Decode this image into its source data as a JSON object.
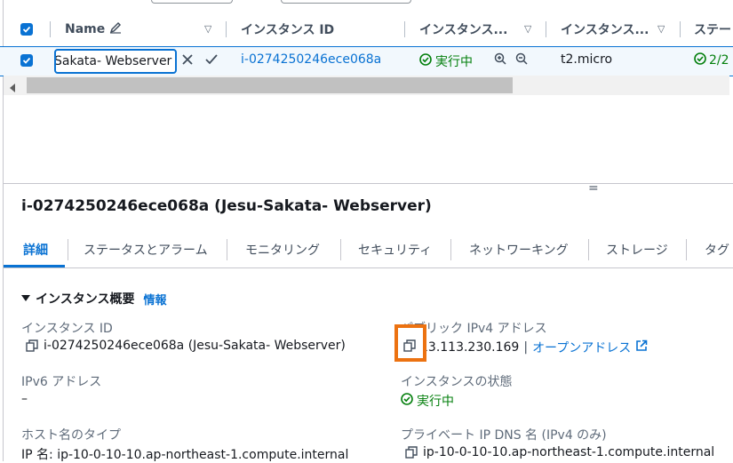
{
  "table": {
    "headers": {
      "name": "Name",
      "instance_id": "インスタンス ID",
      "instance_state": "インスタンス...",
      "instance_type": "インスタンス...",
      "status": "ステー"
    },
    "row": {
      "name_edit_value": "Sakata- Webserver",
      "instance_id": "i-0274250246ece068a",
      "state": "実行中",
      "type": "t2.micro",
      "status_check": "2/2"
    }
  },
  "details": {
    "title": "i-0274250246ece068a (Jesu-Sakata- Webserver)",
    "tabs": [
      "詳細",
      "ステータスとアラーム",
      "モニタリング",
      "セキュリティ",
      "ネットワーキング",
      "ストレージ",
      "タグ"
    ],
    "section_title": "インスタンス概要",
    "info_link": "情報",
    "fields": {
      "instance_id_label": "インスタンス ID",
      "instance_id_value": "i-0274250246ece068a (Jesu-Sakata- Webserver)",
      "public_ipv4_label": "パブリック IPv4 アドレス",
      "public_ipv4_value": "13.113.230.169",
      "open_address_link": "オープンアドレス",
      "ipv6_label": "IPv6 アドレス",
      "ipv6_value": "–",
      "instance_state_label": "インスタンスの状態",
      "instance_state_value": "実行中",
      "hostname_type_label": "ホスト名のタイプ",
      "hostname_type_value": "IP 名: ip-10-0-10-10.ap-northeast-1.compute.internal",
      "private_dns_label": "プライベート IP DNS 名 (IPv4 のみ)",
      "private_dns_value": "ip-10-0-10-10.ap-northeast-1.compute.internal"
    }
  },
  "colors": {
    "accent": "#0972d3",
    "success": "#037f0c",
    "highlight": "#ec7211"
  }
}
